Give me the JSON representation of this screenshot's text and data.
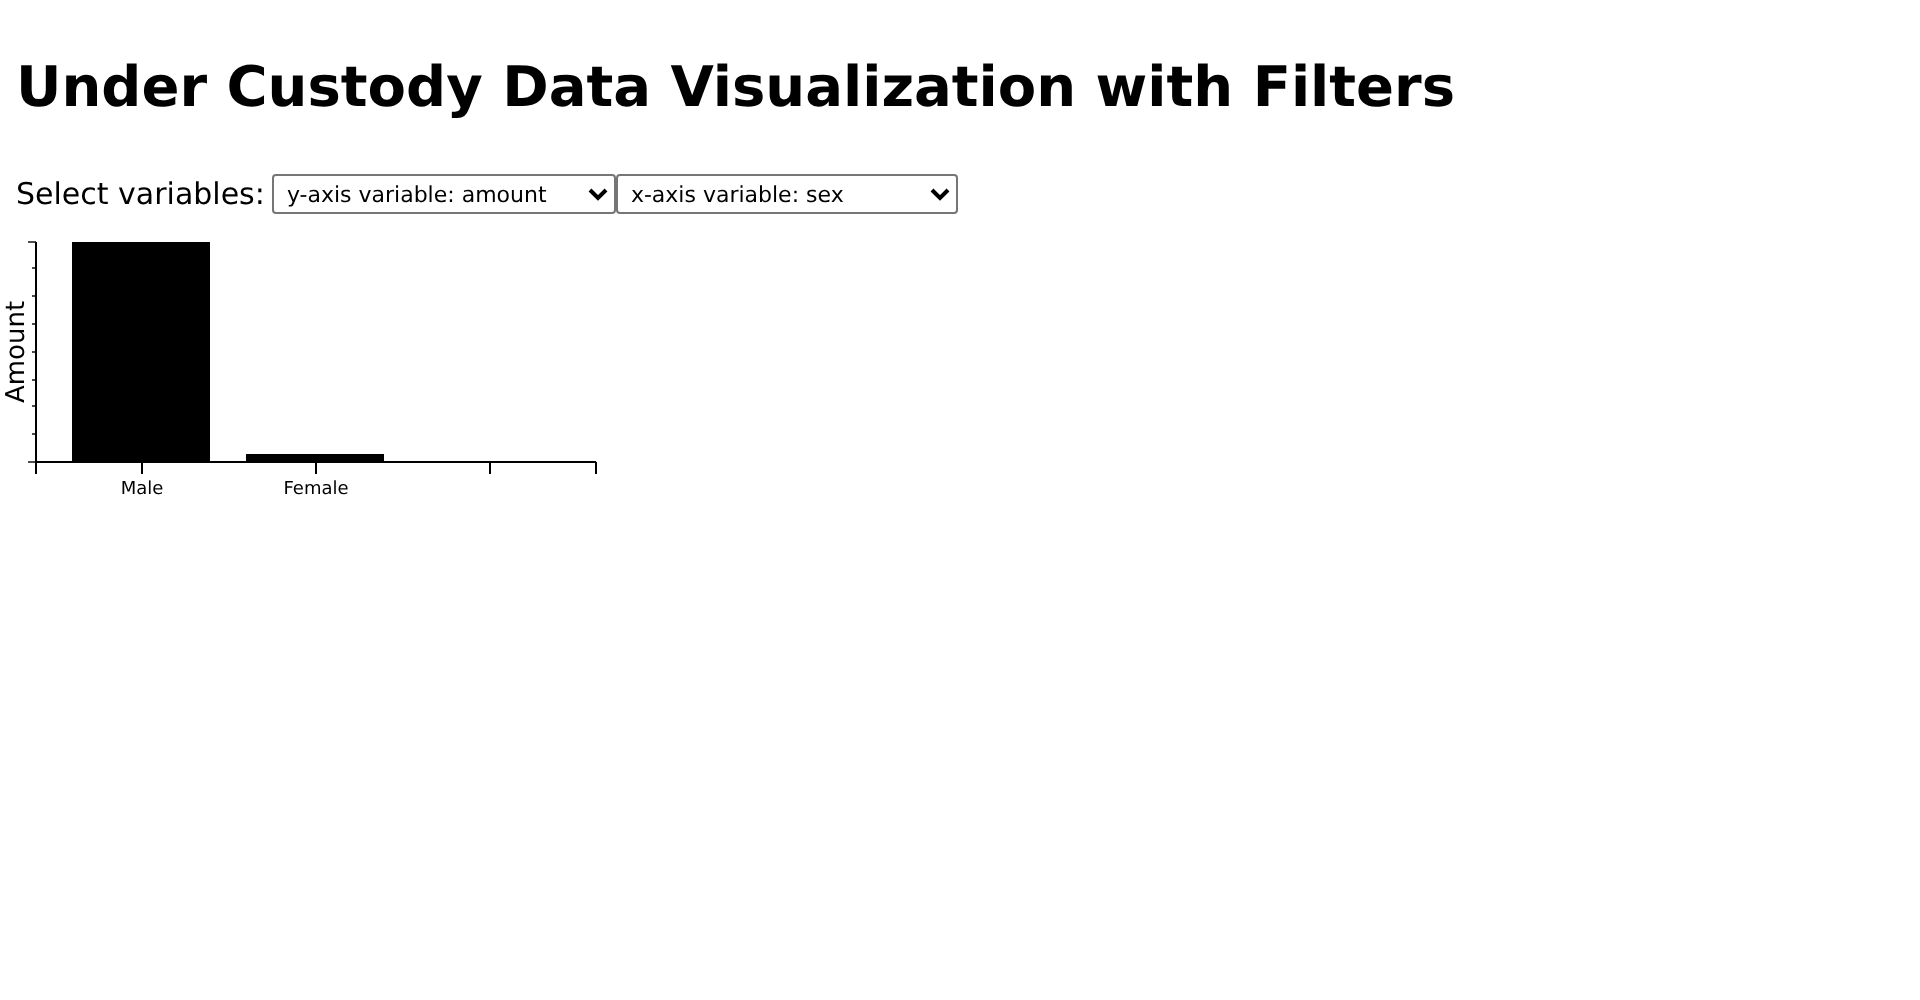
{
  "title": "Under Custody Data Visualization with Filters",
  "controls": {
    "label": "Select variables:",
    "selects": [
      {
        "value": "y-axis variable: amount"
      },
      {
        "value": "x-axis variable: sex"
      }
    ]
  },
  "chart": {
    "ylabel": "Amount",
    "categories": [
      "Male",
      "Female"
    ]
  }
}
